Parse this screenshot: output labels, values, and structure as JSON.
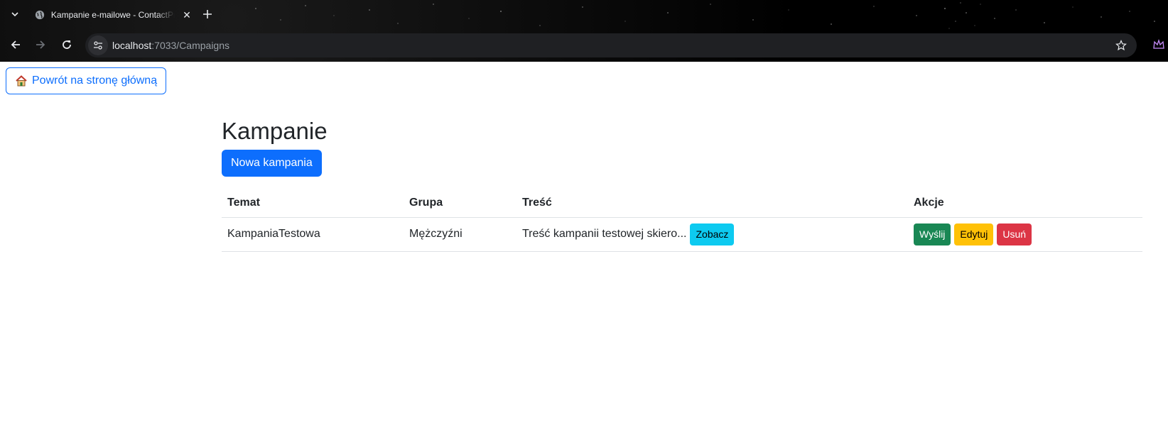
{
  "browser": {
    "tab_title": "Kampanie e-mailowe - ContactPro",
    "url_host": "localhost",
    "url_path": ":7033/Campaigns"
  },
  "page": {
    "home_button": "Powrót na stronę główną",
    "title": "Kampanie",
    "new_campaign_button": "Nowa kampania"
  },
  "table": {
    "headers": [
      "Temat",
      "Grupa",
      "Treść",
      "Akcje"
    ],
    "rows": [
      {
        "temat": "KampaniaTestowa",
        "grupa": "Mężczyźni",
        "tresc": "Treść kampanii testowej skiero...",
        "view_label": "Zobacz",
        "send_label": "Wyślij",
        "edit_label": "Edytuj",
        "delete_label": "Usuń"
      }
    ]
  },
  "colors": {
    "primary": "#0d6efd",
    "info": "#0dcaf0",
    "success": "#198754",
    "warning": "#ffc107",
    "danger": "#dc3545"
  },
  "icons": {
    "home_button": "house-icon"
  }
}
